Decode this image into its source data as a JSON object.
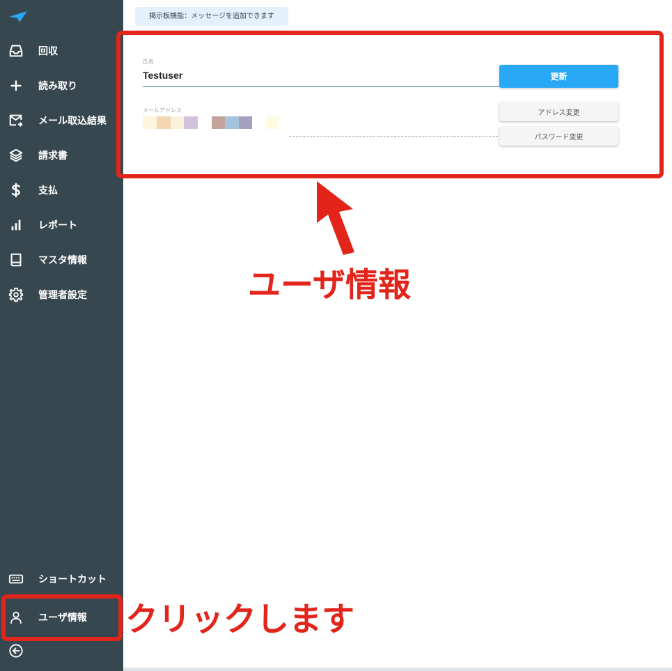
{
  "sidebar": {
    "logo": "logo-icon",
    "items": [
      {
        "label": "回収",
        "icon": "inbox-icon"
      },
      {
        "label": "読み取り",
        "icon": "plus-icon"
      },
      {
        "label": "メール取込結果",
        "icon": "mail-icon"
      },
      {
        "label": "請求書",
        "icon": "layers-icon"
      },
      {
        "label": "支払",
        "icon": "dollar-icon"
      },
      {
        "label": "レポート",
        "icon": "bar-chart-icon"
      },
      {
        "label": "マスタ情報",
        "icon": "book-icon"
      },
      {
        "label": "管理者設定",
        "icon": "gear-icon"
      }
    ],
    "bottom_items": [
      {
        "label": "ショートカット",
        "icon": "keyboard-icon"
      },
      {
        "label": "ユーザ情報",
        "icon": "user-icon"
      }
    ],
    "collapse_icon": "arrow-left-circle-icon"
  },
  "main": {
    "board_chip": "掲示板機能：メッセージを追加できます",
    "user_form": {
      "name_label": "氏名",
      "name_value": "Testuser",
      "email_label": "メールアドレス",
      "update_button": "更新",
      "address_change_button": "アドレス変更",
      "password_change_button": "パスワード変更"
    }
  },
  "annotations": {
    "user_info_caption": "ユーザ情報",
    "click_caption": "クリックします",
    "highlight_color": "#e3241b"
  },
  "colors": {
    "sidebar_bg": "#37474f",
    "accent": "#29a8f5"
  }
}
